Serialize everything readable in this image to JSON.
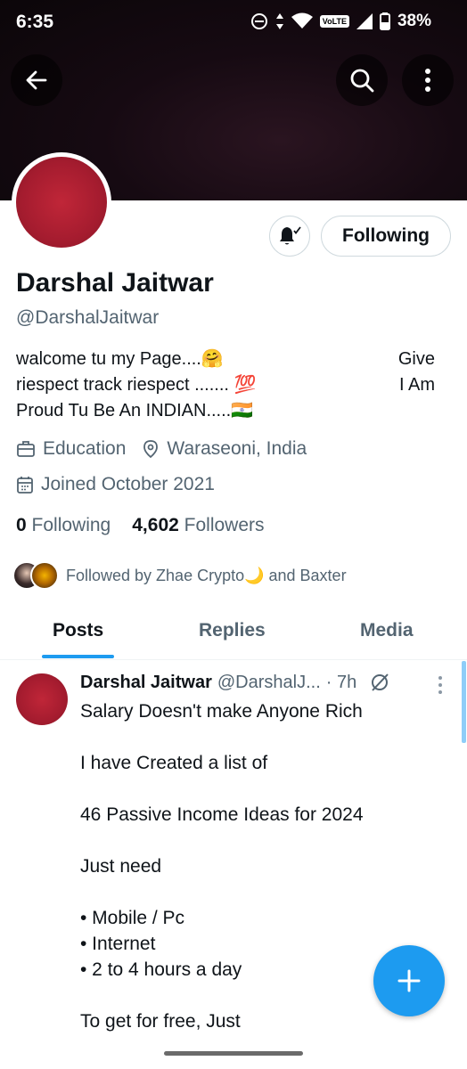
{
  "status_bar": {
    "time": "6:35",
    "network_badge": "VoLTE",
    "battery": "38%"
  },
  "header": {
    "back_icon": "arrow-left-icon",
    "search_icon": "search-icon",
    "more_icon": "more-vertical-icon"
  },
  "profile": {
    "name": "Darshal Jaitwar",
    "handle": "@DarshalJaitwar",
    "bio_lines": [
      {
        "left": "walcome tu my Page....🤗",
        "right": "Give"
      },
      {
        "left": "riespect track riespect ....... 💯",
        "right": "I Am"
      },
      {
        "left": "Proud Tu Be An INDIAN.....🇮🇳",
        "right": ""
      }
    ],
    "category": "Education",
    "location": "Waraseoni, India",
    "joined": "Joined October 2021",
    "following_count": "0",
    "following_label": "Following",
    "followers_count": "4,602",
    "followers_label": "Followers",
    "followed_by": "Followed by Zhae Crypto🌙 and Baxter"
  },
  "actions": {
    "following_button": "Following",
    "bell_icon": "bell-check-icon"
  },
  "tabs": [
    {
      "label": "Posts",
      "active": true
    },
    {
      "label": "Replies",
      "active": false
    },
    {
      "label": "Media",
      "active": false
    }
  ],
  "post": {
    "name": "Darshal Jaitwar",
    "handle": "@DarshalJ...",
    "time": "· 7h",
    "lines": [
      "Salary Doesn't make Anyone Rich",
      "",
      "I have Created a list of",
      "",
      "46 Passive Income Ideas for 2024",
      "",
      "Just need",
      "",
      "• Mobile / Pc",
      "• Internet",
      "• 2 to 4 hours a day",
      "",
      "To get for free, Just"
    ]
  },
  "colors": {
    "accent": "#1d9bf0",
    "text_primary": "#0f1419",
    "text_secondary": "#536471",
    "avatar_red": "#a51c2f"
  }
}
